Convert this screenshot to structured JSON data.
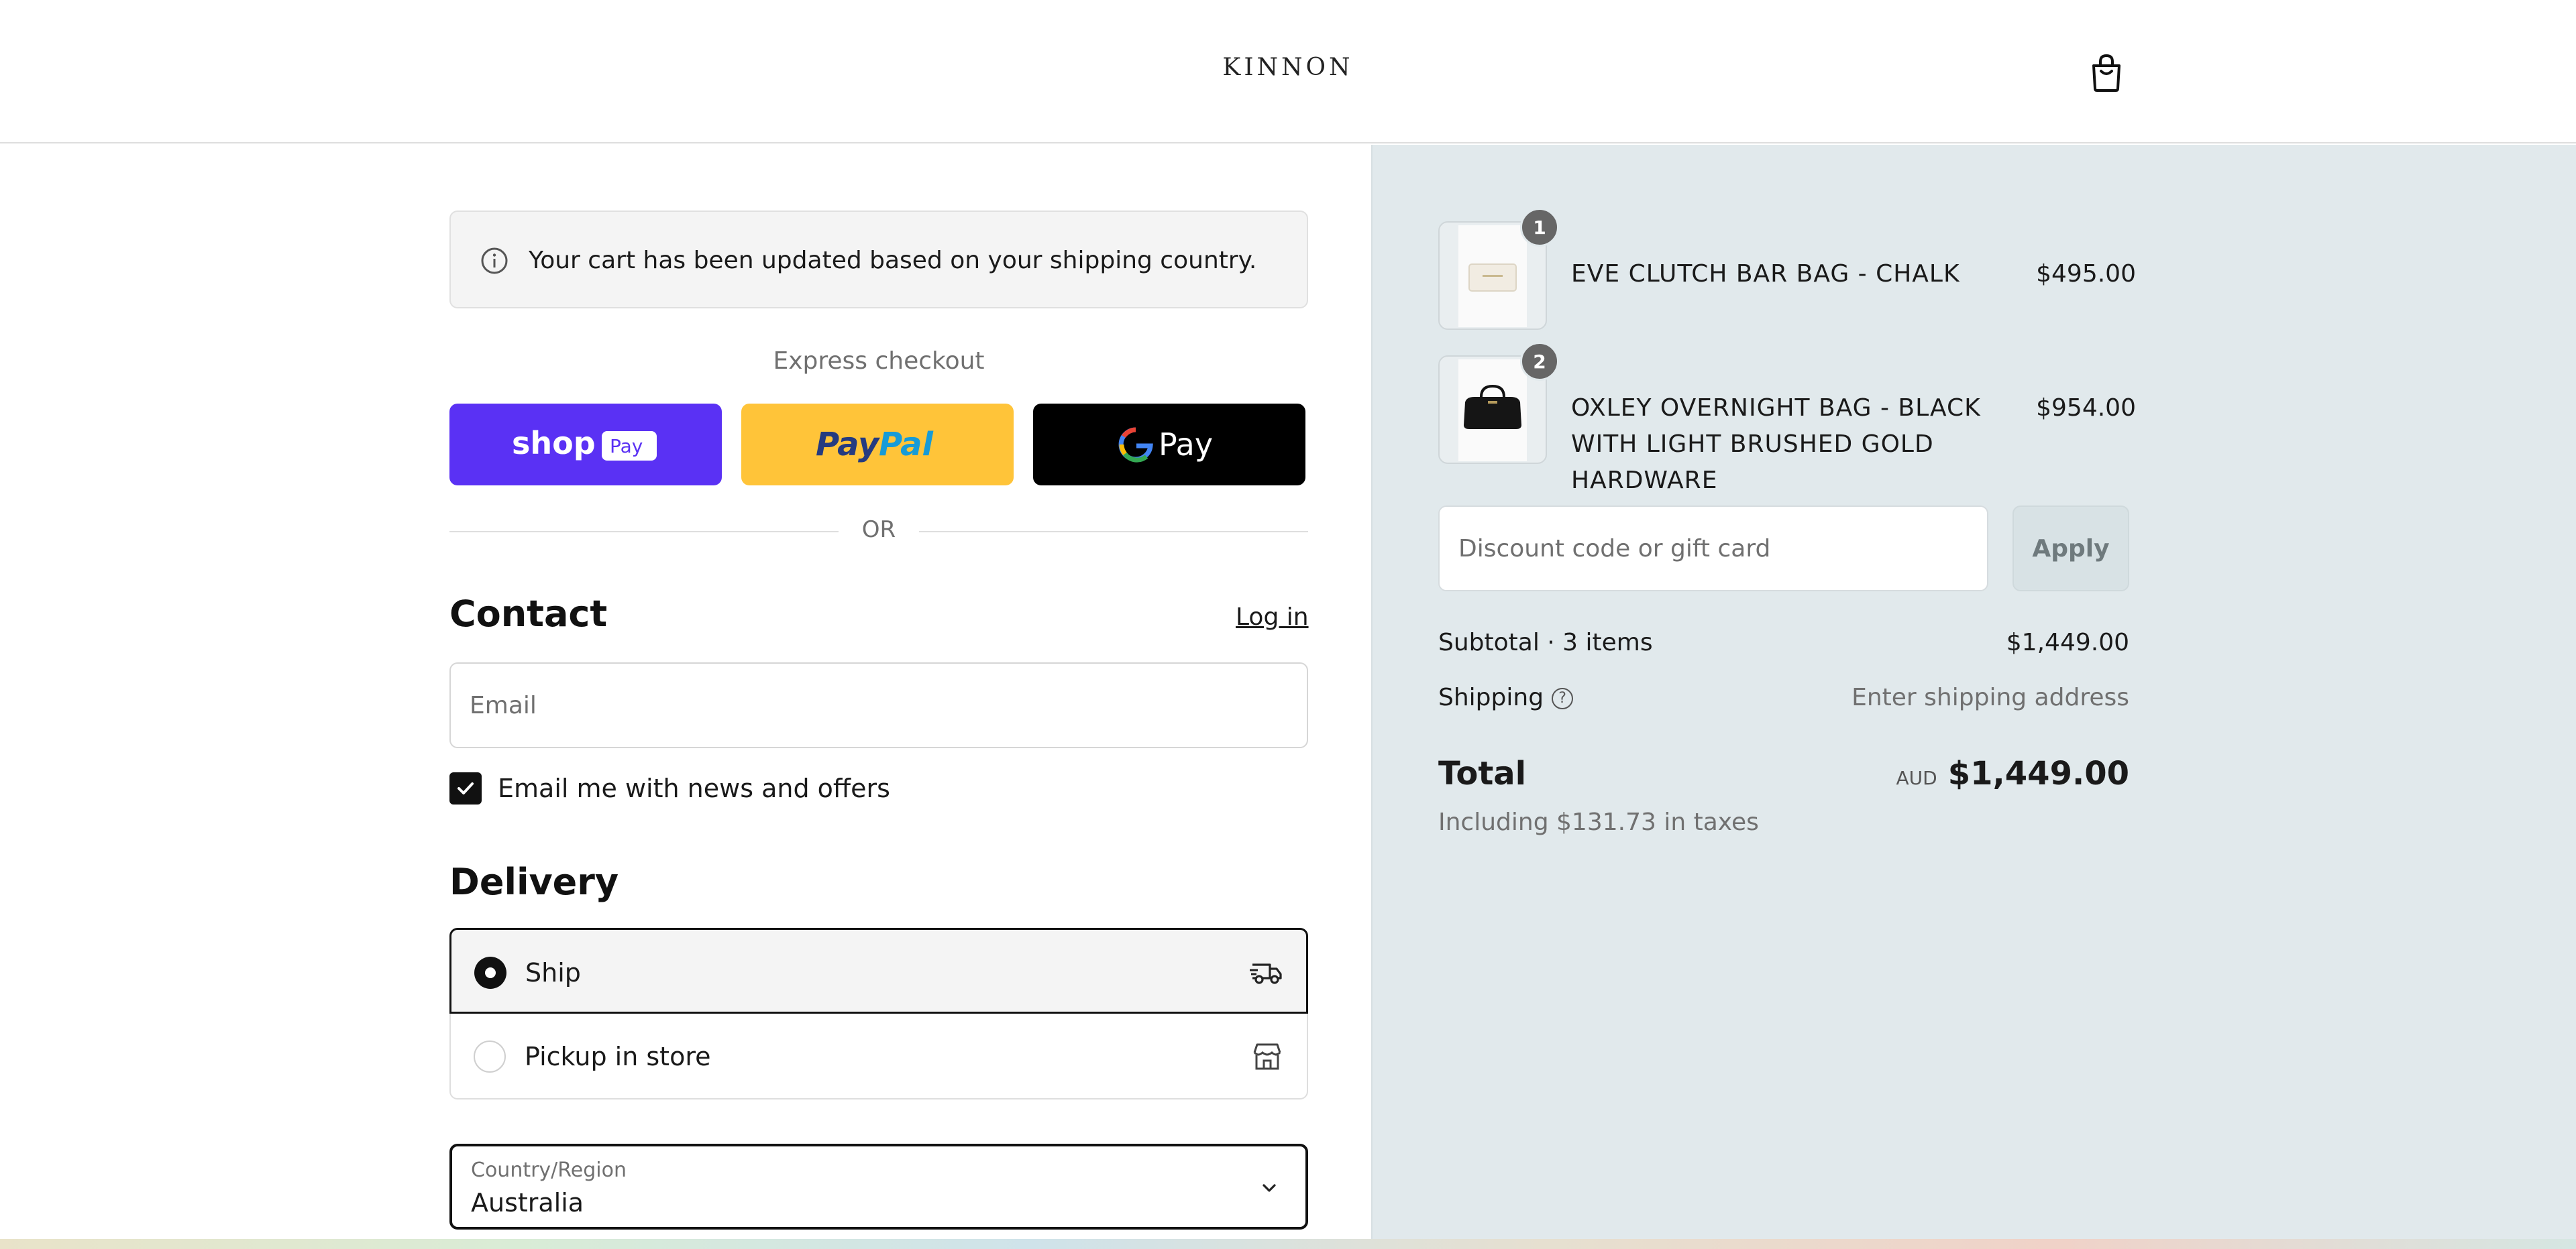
{
  "header": {
    "brand": "KINNON",
    "cart_icon": "shopping-bag-icon"
  },
  "notice": {
    "icon": "info-icon",
    "text": "Your cart has been updated based on your shipping country."
  },
  "express": {
    "title": "Express checkout",
    "buttons": {
      "shop_pay": "Shop Pay",
      "paypal": "PayPal",
      "google_pay": "Pay"
    },
    "or": "OR"
  },
  "contact": {
    "title": "Contact",
    "login": "Log in",
    "email_placeholder": "Email",
    "newsletter_label": "Email me with news and offers",
    "newsletter_checked": true
  },
  "delivery": {
    "title": "Delivery",
    "options": [
      {
        "label": "Ship",
        "selected": true,
        "icon": "delivery-truck-icon"
      },
      {
        "label": "Pickup in store",
        "selected": false,
        "icon": "store-icon"
      }
    ],
    "country_label": "Country/Region",
    "country_value": "Australia"
  },
  "summary": {
    "items": [
      {
        "qty": "1",
        "name": "EVE CLUTCH BAR BAG - CHALK",
        "price": "$495.00"
      },
      {
        "qty": "2",
        "name": "OXLEY OVERNIGHT BAG - BLACK WITH LIGHT BRUSHED GOLD HARDWARE",
        "price": "$954.00"
      }
    ],
    "discount_placeholder": "Discount code or gift card",
    "apply": "Apply",
    "subtotal_label": "Subtotal · 3 items",
    "subtotal_value": "$1,449.00",
    "shipping_label": "Shipping",
    "shipping_value": "Enter shipping address",
    "total_label": "Total",
    "currency": "AUD",
    "total_value": "$1,449.00",
    "taxes": "Including $131.73 in taxes"
  },
  "colors": {
    "shop_pay": "#5a31f4",
    "paypal": "#ffc439",
    "google_pay": "#000000",
    "summary_bg": "#e1e9ec"
  }
}
